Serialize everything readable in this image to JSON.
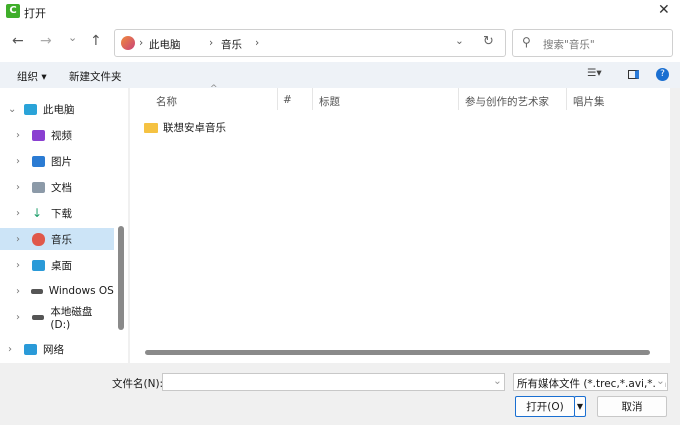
{
  "window": {
    "title": "打开",
    "close": "✕"
  },
  "nav": {
    "back": "←",
    "forward": "→",
    "recent": "⌄",
    "up": "↑",
    "breadcrumb": [
      "此电脑",
      "音乐"
    ],
    "search_placeholder": "搜索\"音乐\""
  },
  "toolbar": {
    "organize": "组织 ▾",
    "new_folder": "新建文件夹"
  },
  "tree": [
    {
      "label": "此电脑",
      "icon": "computer-icon",
      "color": "#2aa3d8",
      "expanded": true,
      "level": 0
    },
    {
      "label": "视频",
      "icon": "video-icon",
      "color": "#8a3fd1",
      "level": 1
    },
    {
      "label": "图片",
      "icon": "pictures-icon",
      "color": "#2b7bd3",
      "level": 1
    },
    {
      "label": "文档",
      "icon": "documents-icon",
      "color": "#8c9aa8",
      "level": 1
    },
    {
      "label": "下载",
      "icon": "download-icon",
      "color": "#1e9e6a",
      "level": 1
    },
    {
      "label": "音乐",
      "icon": "music-icon",
      "color": "#e0584a",
      "level": 1,
      "selected": true
    },
    {
      "label": "桌面",
      "icon": "desktop-icon",
      "color": "#2a9ad8",
      "level": 1
    },
    {
      "label": "Windows OS (",
      "icon": "drive-icon",
      "color": "#555",
      "level": 1
    },
    {
      "label": "本地磁盘 (D:)",
      "icon": "drive-icon",
      "color": "#555",
      "level": 1
    },
    {
      "label": "网络",
      "icon": "network-icon",
      "color": "#2a9ad8",
      "level": 0
    }
  ],
  "columns": [
    "名称",
    "#",
    "标题",
    "参与创作的艺术家",
    "唱片集"
  ],
  "files": [
    {
      "name": "联想安卓音乐",
      "icon": "folder-icon"
    }
  ],
  "bottom": {
    "filename_label": "文件名(N):",
    "filename_value": "",
    "filter": "所有媒体文件 (*.trec,*.avi,*.mp",
    "open": "打开(O)",
    "cancel": "取消"
  }
}
